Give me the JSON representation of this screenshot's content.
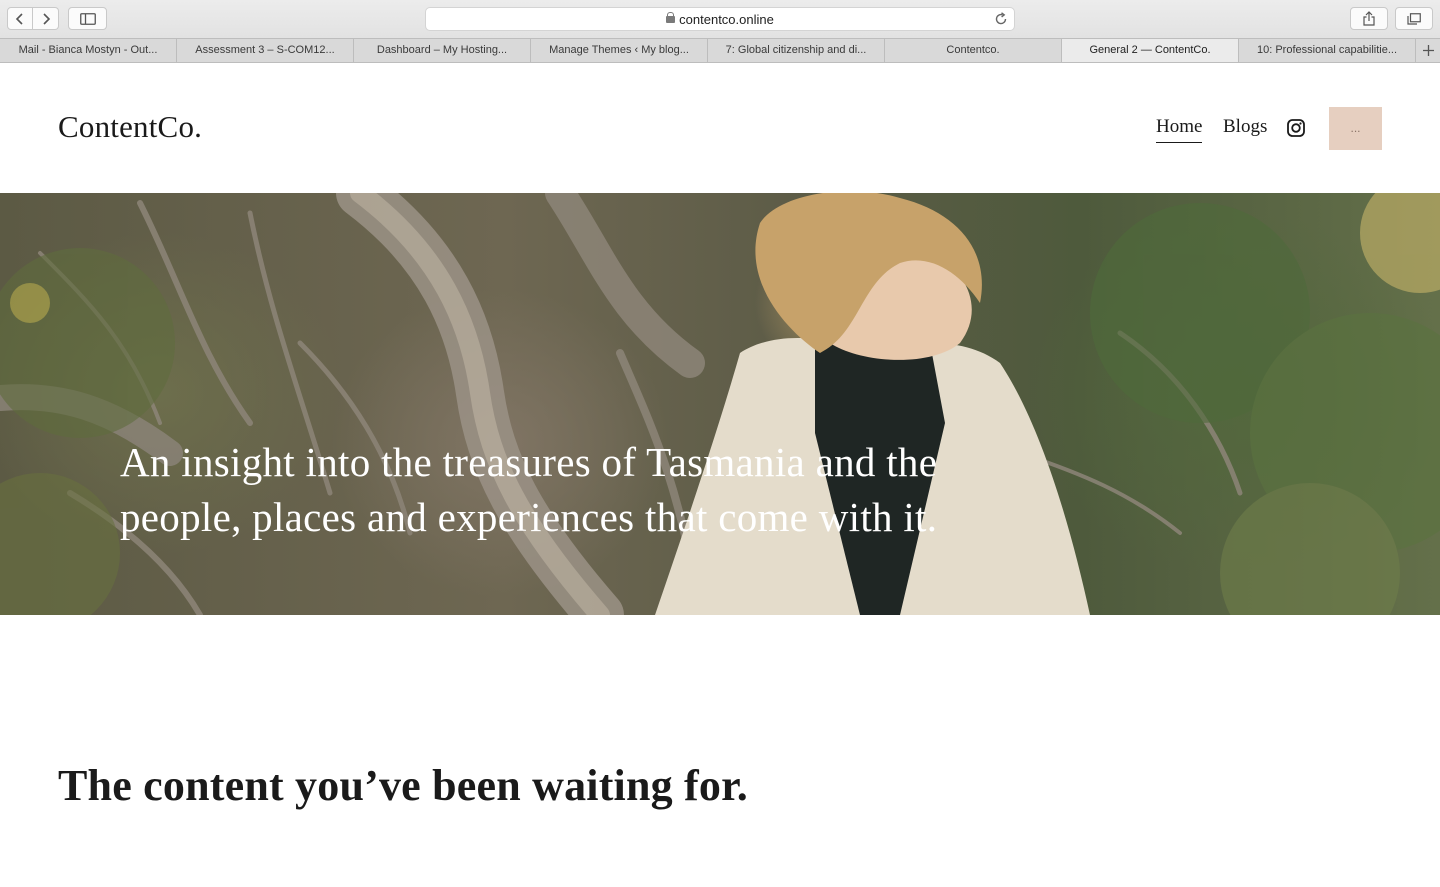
{
  "browser": {
    "url": "contentco.online",
    "tabs": [
      {
        "title": "Mail - Bianca Mostyn - Out..."
      },
      {
        "title": "Assessment 3 – S-COM12..."
      },
      {
        "title": "Dashboard – My Hosting..."
      },
      {
        "title": "Manage Themes ‹ My blog..."
      },
      {
        "title": "7: Global citizenship and di..."
      },
      {
        "title": "Contentco."
      },
      {
        "title": "General 2 — ContentCo."
      },
      {
        "title": "10: Professional capabilitie..."
      }
    ],
    "active_tab": 6
  },
  "header": {
    "logo": "ContentCo.",
    "nav": {
      "home": "Home",
      "blogs": "Blogs"
    },
    "cta_label": "...",
    "cta_color": "#e6cfc0"
  },
  "hero": {
    "headline": "An insight into the treasures of Tasmania and the people, places and experiences that come with it."
  },
  "content": {
    "title": "The content you’ve been waiting for."
  },
  "icons": [
    "chevron-left-icon",
    "chevron-right-icon",
    "sidebar-icon",
    "lock-icon",
    "reload-icon",
    "share-icon",
    "tabs-icon",
    "plus-icon",
    "instagram-icon"
  ]
}
